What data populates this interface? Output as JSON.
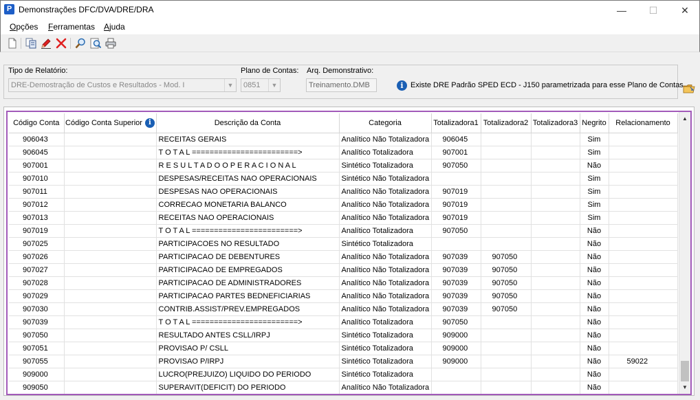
{
  "window": {
    "title": "Demonstrações DFC/DVA/DRE/DRA",
    "app_icon_letter": "P",
    "controls": {
      "minimize": "—",
      "maximize": "☐",
      "close": "✕"
    }
  },
  "menu": [
    {
      "pre": "",
      "accel": "O",
      "post": "pções"
    },
    {
      "pre": "",
      "accel": "F",
      "post": "erramentas"
    },
    {
      "pre": "",
      "accel": "A",
      "post": "juda"
    }
  ],
  "toolbar": {
    "icons": [
      "new-document-icon",
      "copy-icon",
      "edit-pencil-icon",
      "delete-x-icon",
      "search-icon",
      "zoom-preview-icon",
      "print-icon"
    ]
  },
  "filters": {
    "report_type_label": "Tipo de Relatório:",
    "report_type_value": "DRE-Demostração de Custos e Resultados - Mod. I",
    "chart_label": "Plano de Contas:",
    "chart_value": "0851",
    "file_label": "Arq. Demonstrativo:",
    "file_value": "Treinamento.DMB",
    "info_message": "Existe DRE Padrão SPED ECD - J150 parametrizada para esse Plano de Contas"
  },
  "grid": {
    "columns": [
      "Código Conta",
      "Código Conta Superior",
      "Descrição da Conta",
      "Categoria",
      "Totalizadora1",
      "Totalizadora2",
      "Totalizadora3",
      "Negrito",
      "Relacionamento"
    ],
    "rows": [
      [
        "906043",
        "",
        "RECEITAS GERAIS",
        "Analítico Não Totalizadora",
        "906045",
        "",
        "",
        "Sim",
        ""
      ],
      [
        "906045",
        "",
        "T O T A L ========================>",
        "Analítico Totalizadora",
        "907001",
        "",
        "",
        "Sim",
        ""
      ],
      [
        "907001",
        "",
        "R E S U L T A D O     O P E R A C I O N A L",
        "Sintético Totalizadora",
        "907050",
        "",
        "",
        "Não",
        ""
      ],
      [
        "907010",
        "",
        "DESPESAS/RECEITAS NAO OPERACIONAIS",
        "Sintético Não Totalizadora",
        "",
        "",
        "",
        "Sim",
        ""
      ],
      [
        "907011",
        "",
        "DESPESAS NAO OPERACIONAIS",
        "Analítico Não Totalizadora",
        "907019",
        "",
        "",
        "Sim",
        ""
      ],
      [
        "907012",
        "",
        "CORRECAO MONETARIA BALANCO",
        "Analítico Não Totalizadora",
        "907019",
        "",
        "",
        "Sim",
        ""
      ],
      [
        "907013",
        "",
        "RECEITAS NAO OPERACIONAIS",
        "Analítico Não Totalizadora",
        "907019",
        "",
        "",
        "Sim",
        ""
      ],
      [
        "907019",
        "",
        "T O T A L ========================>",
        "Analítico Totalizadora",
        "907050",
        "",
        "",
        "Não",
        ""
      ],
      [
        "907025",
        "",
        "PARTICIPACOES NO RESULTADO",
        "Sintético Totalizadora",
        "",
        "",
        "",
        "Não",
        ""
      ],
      [
        "907026",
        "",
        "PARTICIPACAO DE DEBENTURES",
        "Analítico Não Totalizadora",
        "907039",
        "907050",
        "",
        "Não",
        ""
      ],
      [
        "907027",
        "",
        "PARTICIPACAO DE EMPREGADOS",
        "Analítico Não Totalizadora",
        "907039",
        "907050",
        "",
        "Não",
        ""
      ],
      [
        "907028",
        "",
        "PARTICIPACAO DE ADMINISTRADORES",
        "Analítico Não Totalizadora",
        "907039",
        "907050",
        "",
        "Não",
        ""
      ],
      [
        "907029",
        "",
        "PARTICIPACAO PARTES BEDNEFICIARIAS",
        "Analítico Não Totalizadora",
        "907039",
        "907050",
        "",
        "Não",
        ""
      ],
      [
        "907030",
        "",
        "CONTRIB.ASSIST/PREV.EMPREGADOS",
        "Analítico Não Totalizadora",
        "907039",
        "907050",
        "",
        "Não",
        ""
      ],
      [
        "907039",
        "",
        "T O T A L ========================>",
        "Analítico Totalizadora",
        "907050",
        "",
        "",
        "Não",
        ""
      ],
      [
        "907050",
        "",
        "RESULTADO ANTES CSLL/IRPJ",
        "Sintético Totalizadora",
        "909000",
        "",
        "",
        "Não",
        ""
      ],
      [
        "907051",
        "",
        "PROVISAO P/ CSLL",
        "Sintético Totalizadora",
        "909000",
        "",
        "",
        "Não",
        ""
      ],
      [
        "907055",
        "",
        "PROVISAO P/IRPJ",
        "Sintético Totalizadora",
        "909000",
        "",
        "",
        "Não",
        "59022"
      ],
      [
        "909000",
        "",
        "LUCRO(PREJUIZO) LIQUIDO DO PERIODO",
        "Sintético Totalizadora",
        "",
        "",
        "",
        "Não",
        ""
      ],
      [
        "909050",
        "",
        "SUPERAVIT(DEFICIT) DO PERIODO",
        "Analítico Não Totalizadora",
        "",
        "",
        "",
        "Não",
        ""
      ]
    ]
  }
}
